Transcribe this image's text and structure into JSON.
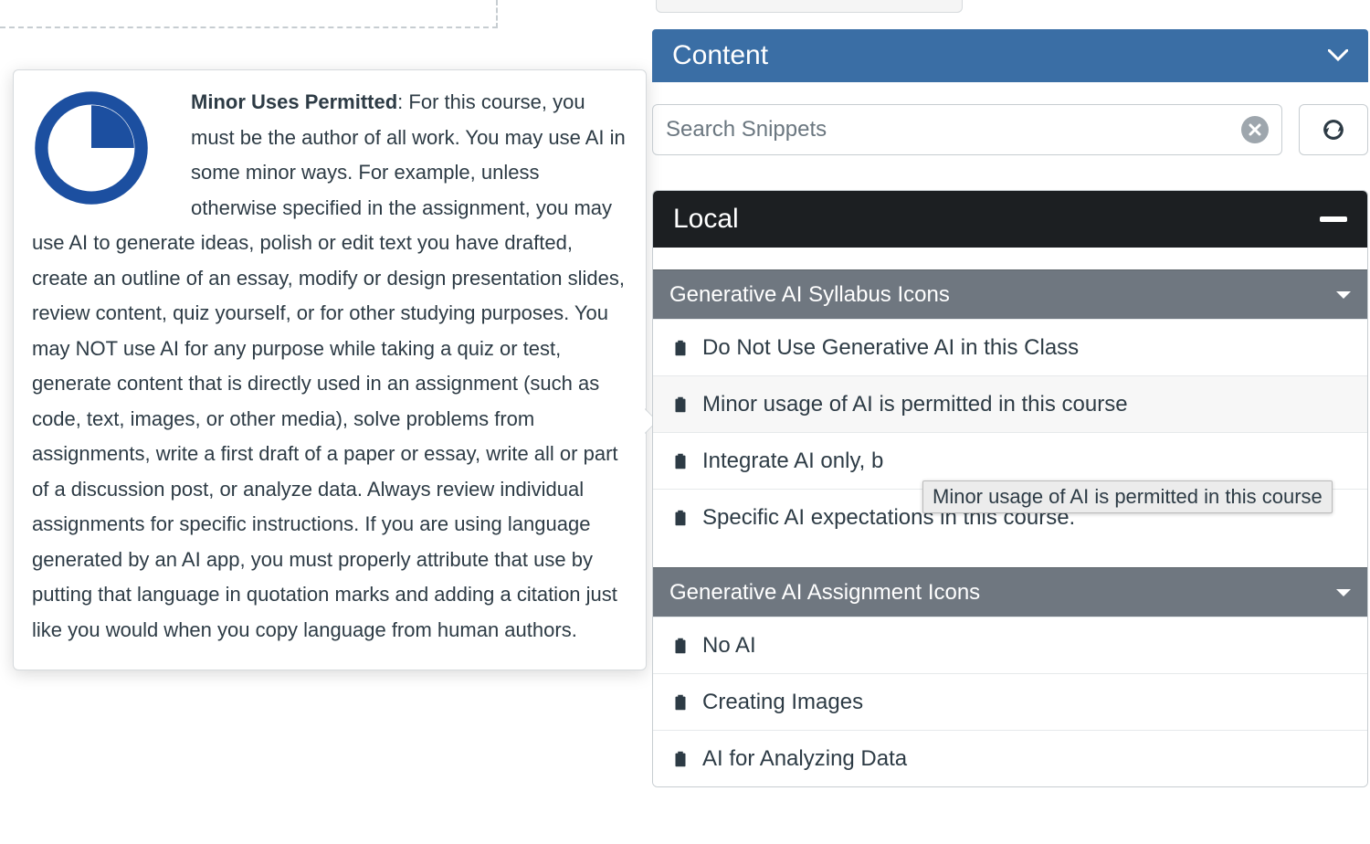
{
  "callout": {
    "title": "Minor Uses Permitted",
    "body": ": For this course, you must be the author of all work. You may use AI in some minor ways. For example, unless otherwise specified in the assignment, you may use AI to generate ideas, polish or edit text you have drafted, create an outline of an essay, modify or design presentation slides, review content, quiz yourself, or for other studying purposes. You may NOT use AI for any purpose while taking a quiz or test, generate content that is directly used in an assignment (such as code, text, images, or other media), solve problems from assignments, write a first draft of a paper or essay, write all or part of a discussion post, or analyze data. Always review individual assignments for specific instructions. If you are using language generated by an AI app, you must properly attribute that use by putting that language in quotation marks and adding a citation just like you would when you copy language from human authors."
  },
  "sidebar": {
    "content_header": "Content",
    "search_placeholder": "Search Snippets",
    "panel_header": "Local",
    "groups": [
      {
        "title": "Generative AI Syllabus Icons",
        "items": [
          "Do Not Use Generative AI in this Class",
          "Minor usage of AI is permitted in this course",
          "Integrate AI only, b",
          "Specific AI expectations in this course."
        ]
      },
      {
        "title": "Generative AI Assignment Icons",
        "items": [
          "No AI",
          "Creating Images",
          "AI for Analyzing Data"
        ]
      }
    ],
    "tooltip": "Minor usage of AI is permitted in this course"
  },
  "colors": {
    "content_header_bg": "#3a6ea5",
    "panel_header_bg": "#1c1f22",
    "group_header_bg": "#6f7780",
    "icon_blue": "#1c4fa0"
  }
}
